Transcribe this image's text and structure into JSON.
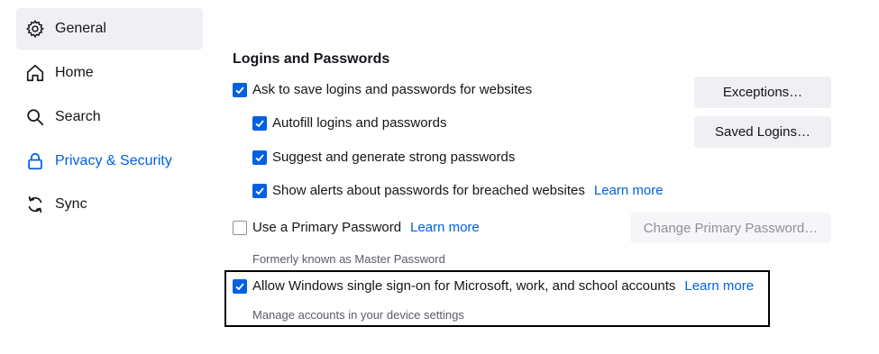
{
  "sidebar": {
    "items": [
      {
        "label": "General",
        "icon": "gear-icon"
      },
      {
        "label": "Home",
        "icon": "home-icon"
      },
      {
        "label": "Search",
        "icon": "search-icon"
      },
      {
        "label": "Privacy & Security",
        "icon": "lock-icon"
      },
      {
        "label": "Sync",
        "icon": "sync-icon"
      }
    ]
  },
  "logins": {
    "title": "Logins and Passwords",
    "ask_save": {
      "label": "Ask to save logins and passwords for websites",
      "checked": true
    },
    "autofill": {
      "label": "Autofill logins and passwords",
      "checked": true
    },
    "suggest": {
      "label": "Suggest and generate strong passwords",
      "checked": true
    },
    "breach_alerts": {
      "label": "Show alerts about passwords for breached websites",
      "checked": true,
      "link": "Learn more"
    },
    "primary_password": {
      "label": "Use a Primary Password",
      "checked": false,
      "link": "Learn more",
      "hint": "Formerly known as Master Password"
    },
    "windows_sso": {
      "label": "Allow Windows single sign-on for Microsoft, work, and school accounts",
      "checked": true,
      "link": "Learn more",
      "hint": "Manage accounts in your device settings"
    },
    "buttons": {
      "exceptions": "Exceptions…",
      "saved_logins": "Saved Logins…",
      "change_primary": "Change Primary Password…"
    }
  },
  "colors": {
    "accent": "#0061e0",
    "button_bg": "#f0f0f4",
    "text": "#15141a",
    "muted": "#5b5b66"
  }
}
